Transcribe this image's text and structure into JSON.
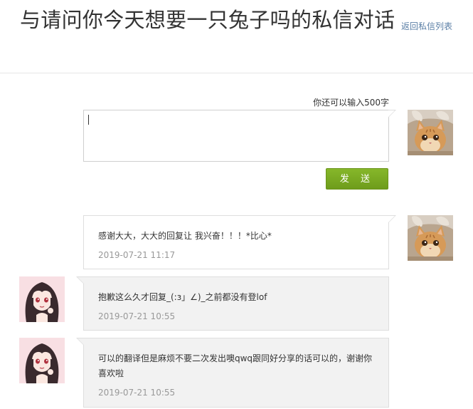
{
  "header": {
    "title": "与请问你今天想要一只兔子吗的私信对话",
    "back_link": "返回私信列表"
  },
  "compose": {
    "char_count": "你还可以输入500字",
    "text": "",
    "send_label": "发 送"
  },
  "messages": [
    {
      "sender": "me",
      "avatar": "kitten-avatar",
      "text": "感谢大大，大大的回复让 我兴奋！！！*比心*",
      "time": "2019-07-21 11:17"
    },
    {
      "sender": "them",
      "avatar": "anime-girl-avatar",
      "text": "抱歉这么久才回复_(:з」∠)_之前都没有登lof",
      "time": "2019-07-21 10:55"
    },
    {
      "sender": "them",
      "avatar": "anime-girl-avatar",
      "text": "可以的翻译但是麻烦不要二次发出噢qwq跟同好分享的话可以的，谢谢你喜欢啦",
      "time": "2019-07-21 10:55"
    }
  ],
  "colors": {
    "send_button": "#7aac22",
    "link": "#5b7fa6",
    "timestamp": "#999999",
    "their_bubble_bg": "#f2f2f2"
  }
}
